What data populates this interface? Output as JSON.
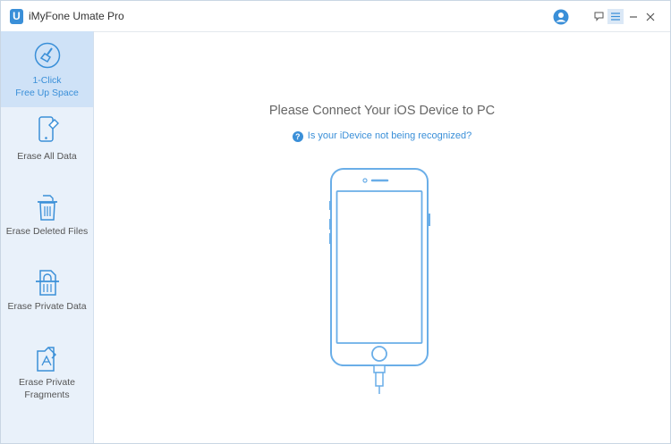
{
  "app": {
    "title": "iMyFone Umate Pro",
    "logo_letter": "U"
  },
  "titlebar": {
    "icons": [
      "user-icon",
      "feedback-icon",
      "menu-icon",
      "minimize-icon",
      "close-icon"
    ]
  },
  "sidebar": {
    "items": [
      {
        "line1": "1-Click",
        "line2": "Free Up Space",
        "icon": "broom-icon",
        "active": true
      },
      {
        "line1": "Erase All Data",
        "line2": "",
        "icon": "phone-erase-icon",
        "active": false
      },
      {
        "line1": "Erase Deleted Files",
        "line2": "",
        "icon": "trash-icon",
        "active": false
      },
      {
        "line1": "Erase Private Data",
        "line2": "",
        "icon": "private-data-icon",
        "active": false
      },
      {
        "line1": "Erase Private",
        "line2": "Fragments",
        "icon": "fragments-icon",
        "active": false
      }
    ]
  },
  "main": {
    "heading": "Please Connect Your iOS Device to PC",
    "help_icon": "?",
    "help_link": "Is your iDevice not being recognized?"
  },
  "colors": {
    "accent": "#3a8fd8",
    "sidebar_bg": "#e9f1fa",
    "sidebar_active": "#cfe2f7"
  }
}
